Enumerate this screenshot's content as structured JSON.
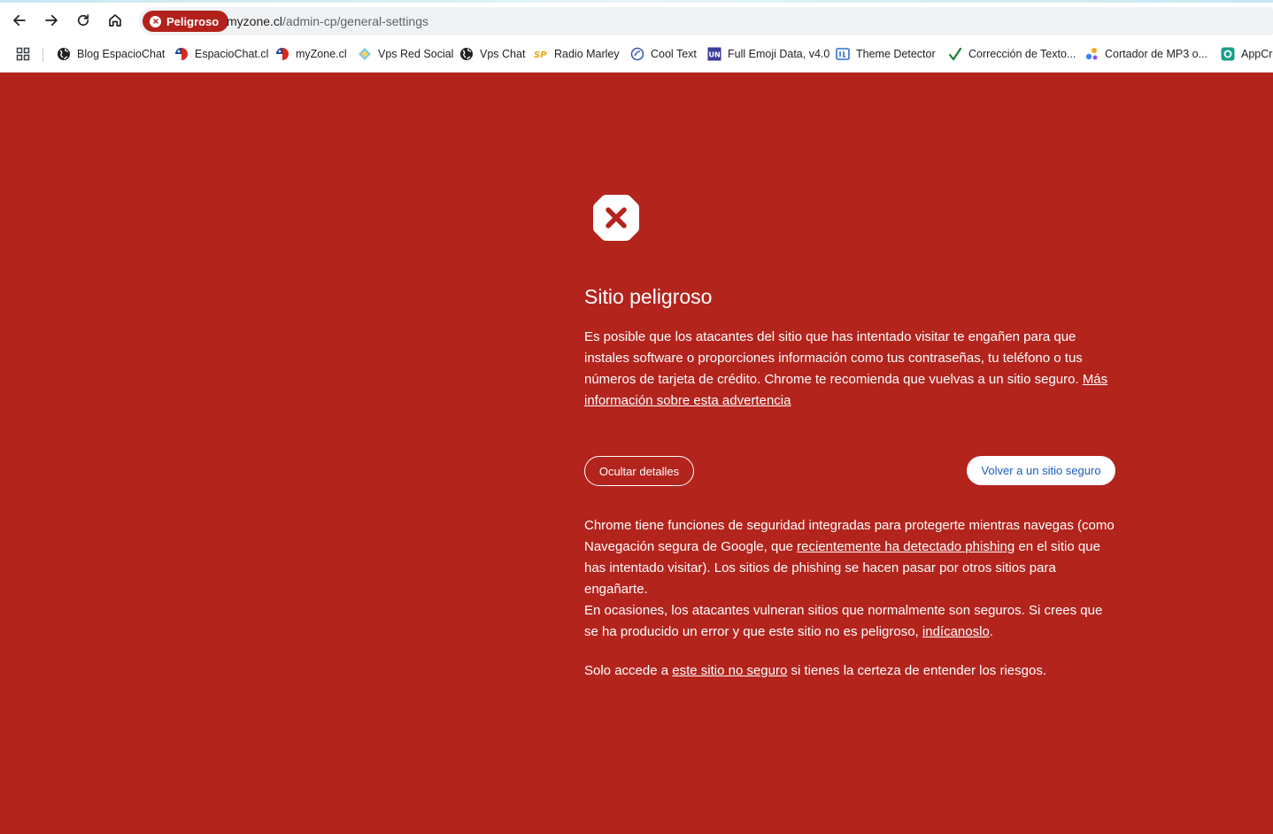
{
  "browser": {
    "security_chip": "Peligroso",
    "url_domain": "myzone.cl",
    "url_path": "/admin-cp/general-settings"
  },
  "bookmarks": [
    {
      "label": "Blog  EspacioChat",
      "icon": "globe-icon"
    },
    {
      "label": "EspacioChat.cl",
      "icon": "chile-flag-icon"
    },
    {
      "label": "myZone.cl",
      "icon": "chile-flag-icon"
    },
    {
      "label": "Vps Red Social",
      "icon": "diamond-icon"
    },
    {
      "label": "Vps Chat",
      "icon": "globe-icon"
    },
    {
      "label": "Radio Marley",
      "icon": "sp-logo-icon"
    },
    {
      "label": "Cool Text",
      "icon": "cooltext-icon"
    },
    {
      "label": "Full Emoji Data, v4.0",
      "icon": "unicode-logo-icon"
    },
    {
      "label": "Theme Detector",
      "icon": "theme-detector-icon"
    },
    {
      "label": "Corrección de Texto...",
      "icon": "checkmark-icon"
    },
    {
      "label": "Cortador de MP3 o...",
      "icon": "dots-logo-icon"
    },
    {
      "label": "AppCre",
      "icon": "appcreator-icon"
    }
  ],
  "warning": {
    "title": "Sitio peligroso",
    "intro": "Es posible que los atacantes del sitio que has intentado visitar te engañen para que instales software o proporciones información como tus contraseñas, tu teléfono o tus números de tarjeta de crédito. Chrome te recomienda que vuelvas a un sitio seguro. ",
    "learn_more_link": "Más información sobre esta advertencia",
    "hide_details_button": "Ocultar detalles",
    "back_button": "Volver a un sitio seguro",
    "details_1_before": "Chrome tiene funciones de seguridad integradas para protegerte mientras navegas (como Navegación segura de Google, que ",
    "details_1_link": "recientemente ha detectado phishing",
    "details_1_after": " en el sitio que has intentado visitar). Los sitios de phishing se hacen pasar por otros sitios para engañarte.",
    "details_2_before": "En ocasiones, los atacantes vulneran sitios que normalmente son seguros. Si crees que se ha producido un error y que este sitio no es peligroso, ",
    "details_2_link": "indícanoslo",
    "details_2_after": ".",
    "details_3_before": "Solo accede a ",
    "details_3_link": "este sitio no seguro",
    "details_3_after": " si tienes la certeza de entender los riesgos."
  },
  "colors": {
    "interstitial_bg": "#b3241d",
    "chip_bg": "#b3211b",
    "back_button_text": "#1a5bbf"
  }
}
